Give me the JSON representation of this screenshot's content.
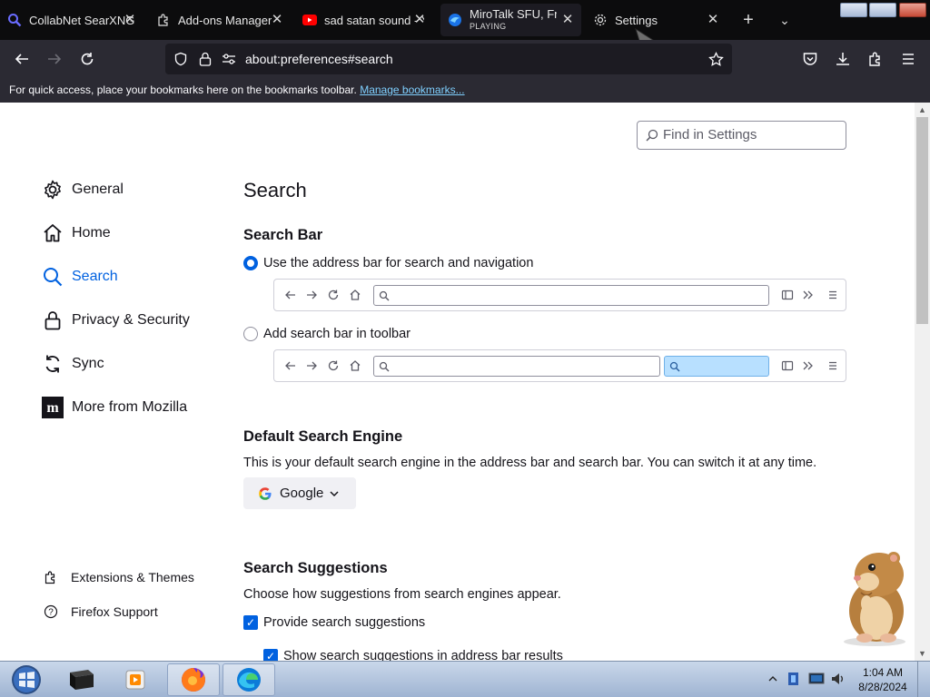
{
  "tabs": [
    {
      "title": "CollabNet SearXNG",
      "icon": "search-icon"
    },
    {
      "title": "Add-ons Manager",
      "icon": "puzzle-icon"
    },
    {
      "title": "sad satan sound - Y",
      "icon": "youtube-icon"
    },
    {
      "title": "MiroTalk SFU, Free",
      "subtitle": "PLAYING",
      "icon": "mirotalk-icon",
      "active": true
    },
    {
      "title": "Settings",
      "icon": "gear-icon"
    }
  ],
  "urlbar": {
    "url": "about:preferences#search"
  },
  "bookmarks": {
    "message": "For quick access, place your bookmarks here on the bookmarks toolbar.",
    "link": "Manage bookmarks..."
  },
  "find": {
    "placeholder": "Find in Settings"
  },
  "categories": [
    {
      "label": "General",
      "icon": "gear-icon"
    },
    {
      "label": "Home",
      "icon": "home-icon"
    },
    {
      "label": "Search",
      "icon": "search-icon",
      "selected": true
    },
    {
      "label": "Privacy & Security",
      "icon": "lock-icon"
    },
    {
      "label": "Sync",
      "icon": "sync-icon"
    },
    {
      "label": "More from Mozilla",
      "icon": "mozilla-icon"
    }
  ],
  "footer_links": [
    {
      "label": "Extensions & Themes",
      "icon": "puzzle-icon"
    },
    {
      "label": "Firefox Support",
      "icon": "help-icon"
    }
  ],
  "page": {
    "title": "Search",
    "search_bar": {
      "heading": "Search Bar",
      "option_address": "Use the address bar for search and navigation",
      "option_toolbar": "Add search bar in toolbar",
      "selected": "address"
    },
    "default_engine": {
      "heading": "Default Search Engine",
      "description": "This is your default search engine in the address bar and search bar. You can switch it at any time.",
      "selected": "Google"
    },
    "suggestions": {
      "heading": "Search Suggestions",
      "description": "Choose how suggestions from search engines appear.",
      "provide": "Provide search suggestions",
      "show_in_address": "Show search suggestions in address bar results"
    }
  },
  "taskbar": {
    "time": "1:04 AM",
    "date": "8/28/2024"
  },
  "colors": {
    "accent": "#0061e0",
    "tabstrip": "#0c0c0d",
    "toolbar": "#2b2a33"
  }
}
